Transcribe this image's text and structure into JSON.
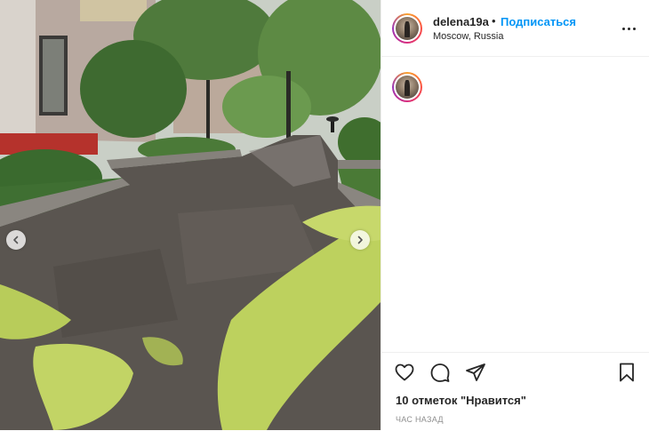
{
  "post": {
    "username": "delena19a",
    "separator": "•",
    "follow_label": "Подписаться",
    "location": "Moscow, Russia",
    "likes_text": "10 отметок \"Нравится\"",
    "timestamp": "ЧАС НАЗАД"
  },
  "icons": {
    "prev": "chevron-left-icon",
    "next": "chevron-right-icon",
    "more": "more-horizontal-icon",
    "like": "heart-icon",
    "comment": "comment-icon",
    "share": "paper-plane-icon",
    "save": "bookmark-icon"
  },
  "colors": {
    "accent": "#0095f6",
    "text": "#262626",
    "muted": "#8e8e8e",
    "divider": "#efefef"
  }
}
